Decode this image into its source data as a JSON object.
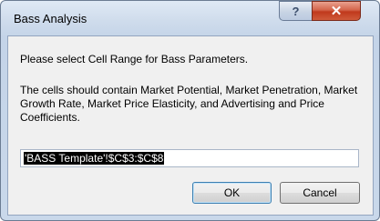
{
  "window": {
    "title": "Bass Analysis"
  },
  "titlebar": {
    "help_glyph": "?",
    "close_glyph": "✕"
  },
  "dialog": {
    "prompt": "Please select Cell Range for Bass Parameters.",
    "description": "The cells should contain Market Potential, Market Penetration, Market Growth Rate, Market Price Elasticity, and Advertising and Price Coefficients.",
    "range_value": "'BASS Template'!$C$3:$C$8",
    "ok_label": "OK",
    "cancel_label": "Cancel"
  }
}
